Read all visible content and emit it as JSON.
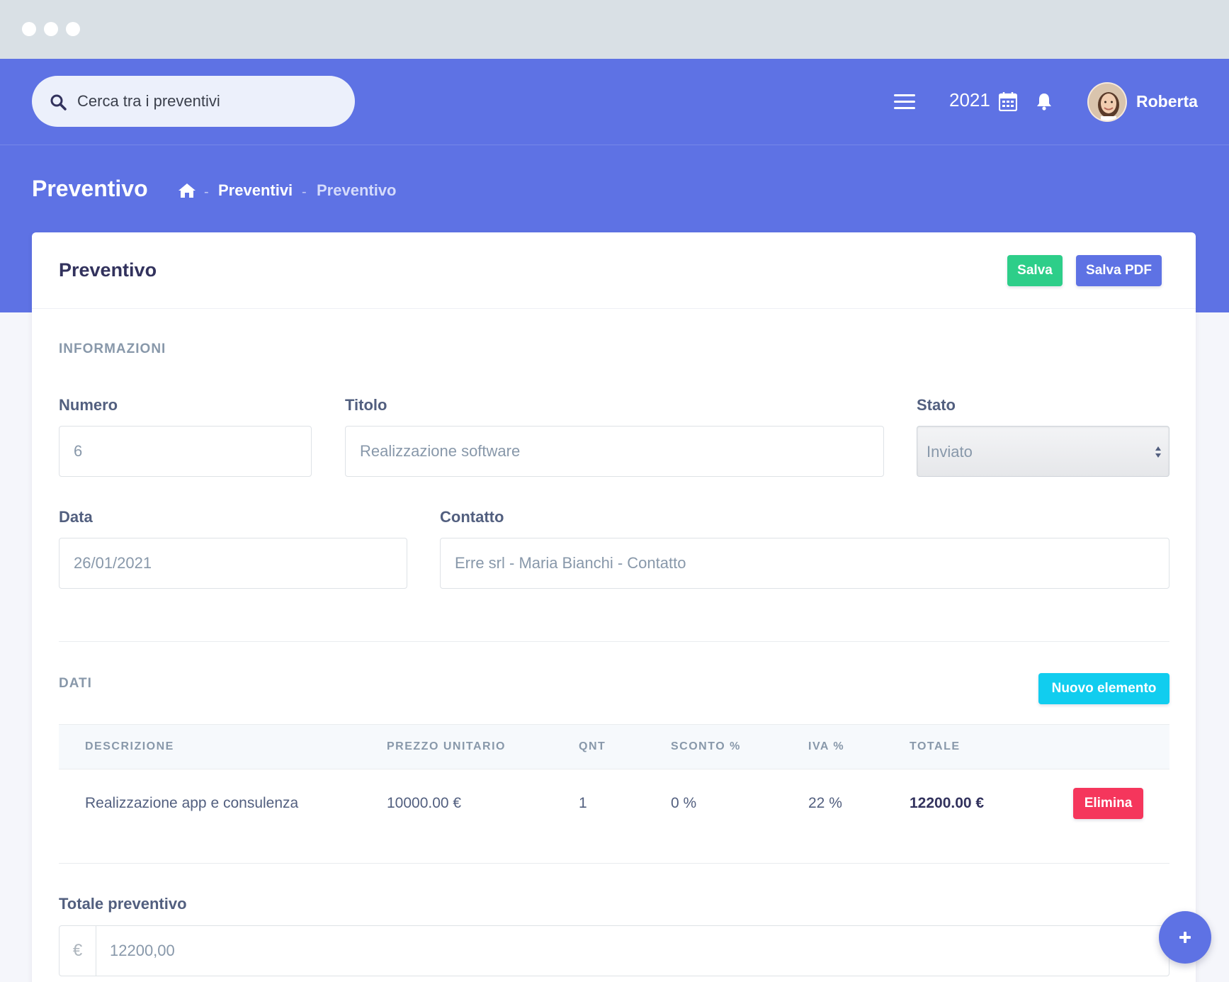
{
  "header": {
    "search_placeholder": "Cerca tra i preventivi",
    "year": "2021",
    "user_name": "Roberta",
    "icons": [
      "search-icon",
      "menu-icon",
      "calendar-icon",
      "bell-icon"
    ]
  },
  "breadcrumb": {
    "page_title": "Preventivo",
    "items": [
      "Preventivi",
      "Preventivo"
    ],
    "separator": "-"
  },
  "card": {
    "title": "Preventivo",
    "save_label": "Salva",
    "save_pdf_label": "Salva PDF"
  },
  "info_section": {
    "label": "INFORMAZIONI",
    "numero": {
      "label": "Numero",
      "value": "6"
    },
    "titolo": {
      "label": "Titolo",
      "value": "Realizzazione software"
    },
    "stato": {
      "label": "Stato",
      "value": "Inviato"
    },
    "data": {
      "label": "Data",
      "value": "26/01/2021"
    },
    "contatto": {
      "label": "Contatto",
      "value": "Erre srl - Maria Bianchi - Contatto"
    }
  },
  "data_section": {
    "label": "DATI",
    "new_item_label": "Nuovo elemento",
    "columns": [
      "DESCRIZIONE",
      "PREZZO UNITARIO",
      "QNT",
      "SCONTO %",
      "IVA %",
      "TOTALE"
    ],
    "rows": [
      {
        "descrizione": "Realizzazione app e consulenza",
        "prezzo": "10000.00 €",
        "qnt": "1",
        "sconto": "0 %",
        "iva": "22 %",
        "totale": "12200.00 €",
        "delete_label": "Elimina"
      }
    ]
  },
  "total_section": {
    "label": "Totale preventivo",
    "currency": "€",
    "value": "12200,00"
  },
  "colors": {
    "primary": "#5e72e4",
    "success": "#2dce89",
    "info": "#11cdef",
    "danger": "#f5365c"
  }
}
